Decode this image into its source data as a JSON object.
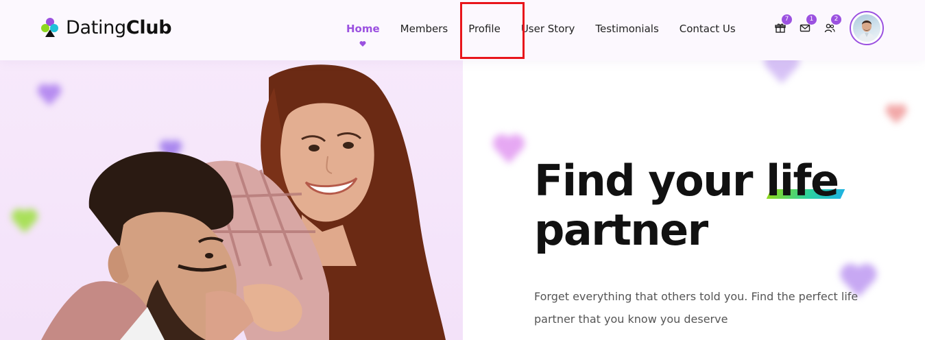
{
  "brand": {
    "name_light": "Dating",
    "name_bold": "Club"
  },
  "nav": {
    "items": [
      {
        "label": "Home",
        "active": true
      },
      {
        "label": "Members",
        "active": false
      },
      {
        "label": "Profile",
        "active": false
      },
      {
        "label": "User Story",
        "active": false
      },
      {
        "label": "Testimonials",
        "active": false
      },
      {
        "label": "Contact Us",
        "active": false
      }
    ]
  },
  "header_icons": {
    "gift": {
      "icon": "gift-icon",
      "badge": "7"
    },
    "mail": {
      "icon": "mail-icon",
      "badge": "1"
    },
    "users": {
      "icon": "users-icon",
      "badge": "2"
    }
  },
  "hero": {
    "title_line1_part1": "Find your ",
    "title_highlight": "life",
    "title_line2": "partner",
    "subtitle": "Forget everything that others told you. Find the perfect life partner that you know you deserve"
  },
  "colors": {
    "accent": "#9b51e0",
    "highlight_box": "#e8151b",
    "hero_bg": "#f5e6fb"
  }
}
